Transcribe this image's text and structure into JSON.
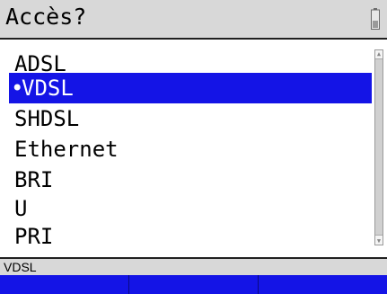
{
  "title": "Accès?",
  "menu": {
    "items": [
      {
        "label": "ADSL",
        "selected": false
      },
      {
        "label": "VDSL",
        "selected": true
      },
      {
        "label": "SHDSL",
        "selected": false
      },
      {
        "label": "Ethernet",
        "selected": false
      },
      {
        "label": "BRI",
        "selected": false
      },
      {
        "label": "U",
        "selected": false
      },
      {
        "label": "PRI",
        "selected": false
      }
    ],
    "selected_marker": "•"
  },
  "status": {
    "text": "VDSL"
  },
  "softkeys": [
    "",
    "",
    ""
  ],
  "icons": {
    "battery": "battery-icon",
    "scroll_up": "scroll-up-arrow-icon",
    "scroll_down": "scroll-down-arrow-icon"
  },
  "colors": {
    "selection": "#1414e6",
    "bar_background": "#d8d8d8",
    "softkey_bar": "#1414e6"
  }
}
